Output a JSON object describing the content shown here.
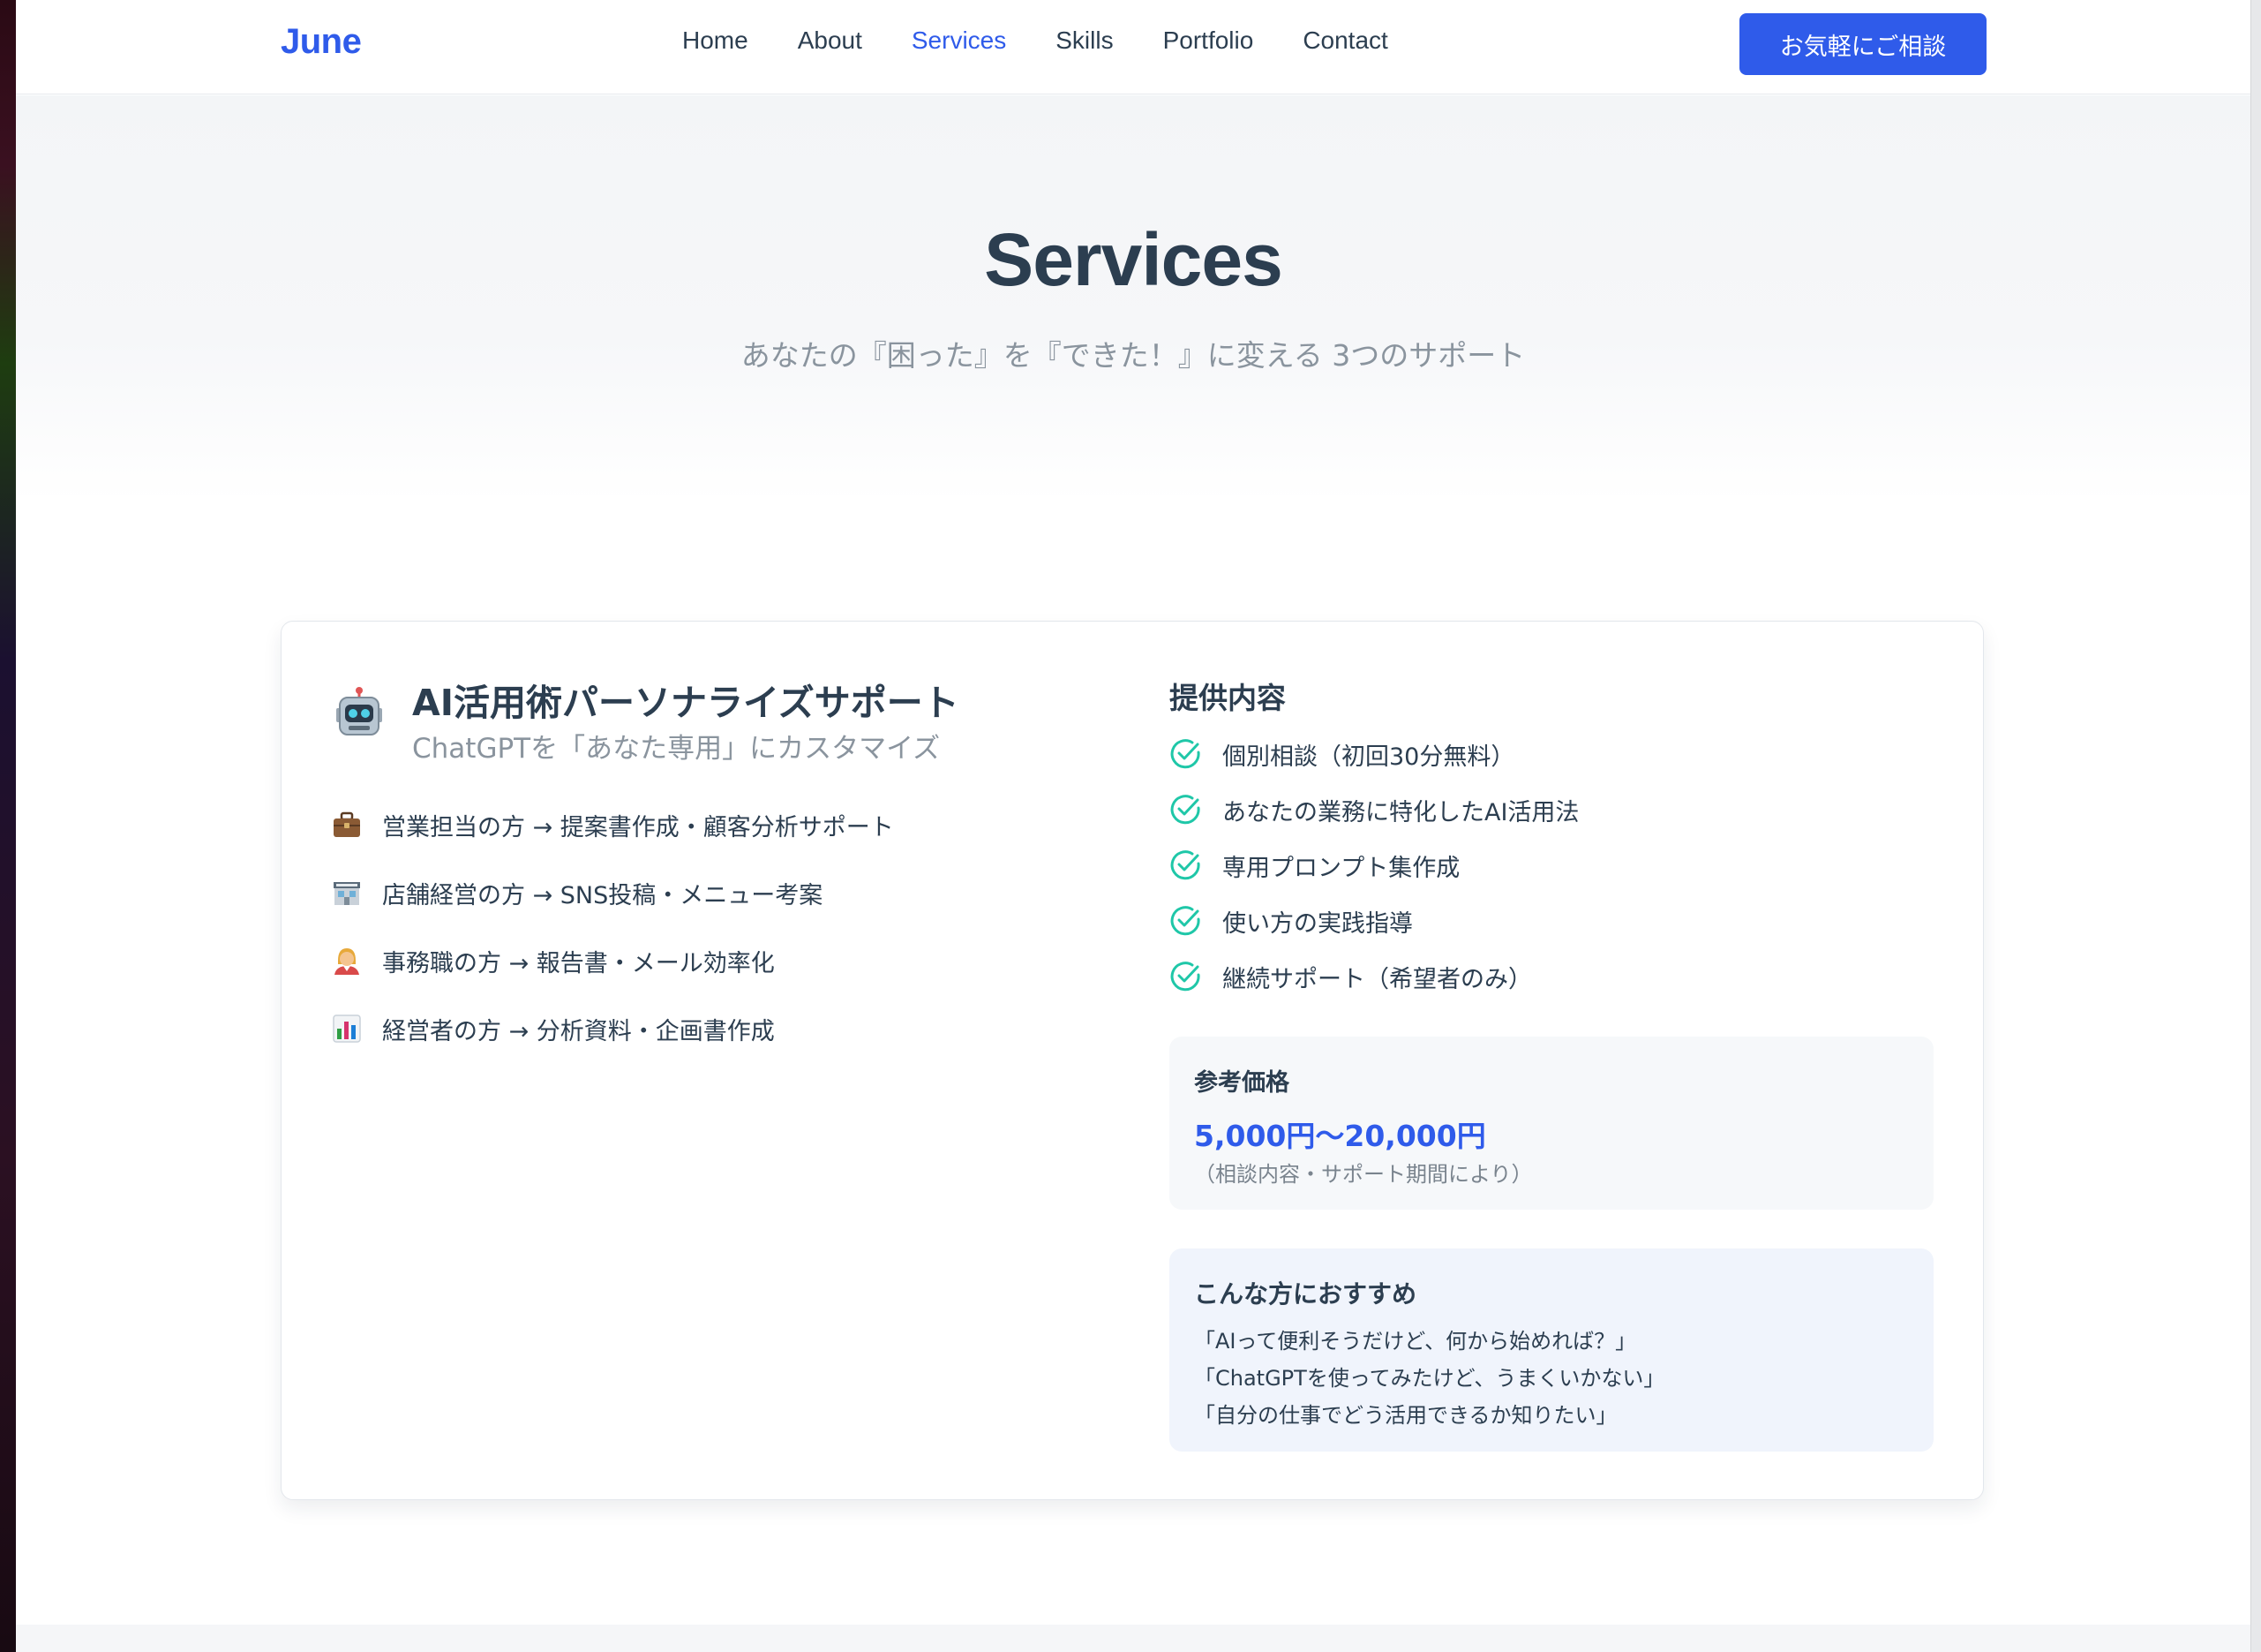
{
  "header": {
    "logo": "June",
    "nav": [
      {
        "label": "Home",
        "active": false
      },
      {
        "label": "About",
        "active": false
      },
      {
        "label": "Services",
        "active": true
      },
      {
        "label": "Skills",
        "active": false
      },
      {
        "label": "Portfolio",
        "active": false
      },
      {
        "label": "Contact",
        "active": false
      }
    ],
    "cta_label": "お気軽にご相談"
  },
  "hero": {
    "title": "Services",
    "subtitle": "あなたの『困った』を『できた！』に変える 3つのサポート"
  },
  "service": {
    "icon": "robot-icon",
    "title": "AI活用術パーソナライズサポート",
    "subtitle": "ChatGPTを「あなた専用」にカスタマイズ",
    "targets": [
      {
        "icon": "briefcase-icon",
        "text": "営業担当の方 → 提案書作成・顧客分析サポート"
      },
      {
        "icon": "store-icon",
        "text": "店舗経営の方 → SNS投稿・メニュー考案"
      },
      {
        "icon": "office-worker-icon",
        "text": "事務職の方 → 報告書・メール効率化"
      },
      {
        "icon": "bar-chart-icon",
        "text": "経営者の方 → 分析資料・企画書作成"
      }
    ],
    "offer_heading": "提供内容",
    "offers": [
      "個別相談（初回30分無料）",
      "あなたの業務に特化したAI活用法",
      "専用プロンプト集作成",
      "使い方の実践指導",
      "継続サポート（希望者のみ）"
    ],
    "price": {
      "label": "参考価格",
      "value": "5,000円〜20,000円",
      "note": "（相談内容・サポート期間により）"
    },
    "recommend": {
      "label": "こんな方におすすめ",
      "lines": [
        "「AIって便利そうだけど、何から始めれば？」",
        "「ChatGPTを使ってみたけど、うまくいかない」",
        "「自分の仕事でどう活用できるか知りたい」"
      ]
    }
  },
  "colors": {
    "accent": "#2f5bea",
    "check": "#1fc7a8",
    "text": "#2c3e50",
    "muted": "#8a949e"
  }
}
